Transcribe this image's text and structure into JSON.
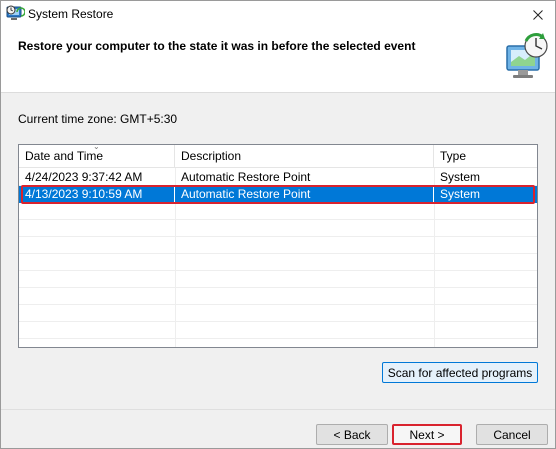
{
  "window": {
    "title": "System Restore",
    "icon": "system-restore-icon"
  },
  "header": {
    "title": "Restore your computer to the state it was in before the selected event",
    "icon": "monitor-restore-icon"
  },
  "timezone": {
    "label": "Current time zone: GMT+5:30"
  },
  "list": {
    "columns": [
      "Date and Time",
      "Description",
      "Type"
    ],
    "rows": [
      {
        "date": "4/24/2023 9:37:42 AM",
        "description": "Automatic Restore Point",
        "type": "System"
      },
      {
        "date": "4/13/2023 9:10:59 AM",
        "description": "Automatic Restore Point",
        "type": "System",
        "selected": true
      }
    ]
  },
  "buttons": {
    "scan": "Scan for affected programs",
    "back": "< Back",
    "next": "Next >",
    "cancel": "Cancel"
  },
  "colors": {
    "selection": "#0078d7",
    "highlight_outline": "#d9232e"
  }
}
